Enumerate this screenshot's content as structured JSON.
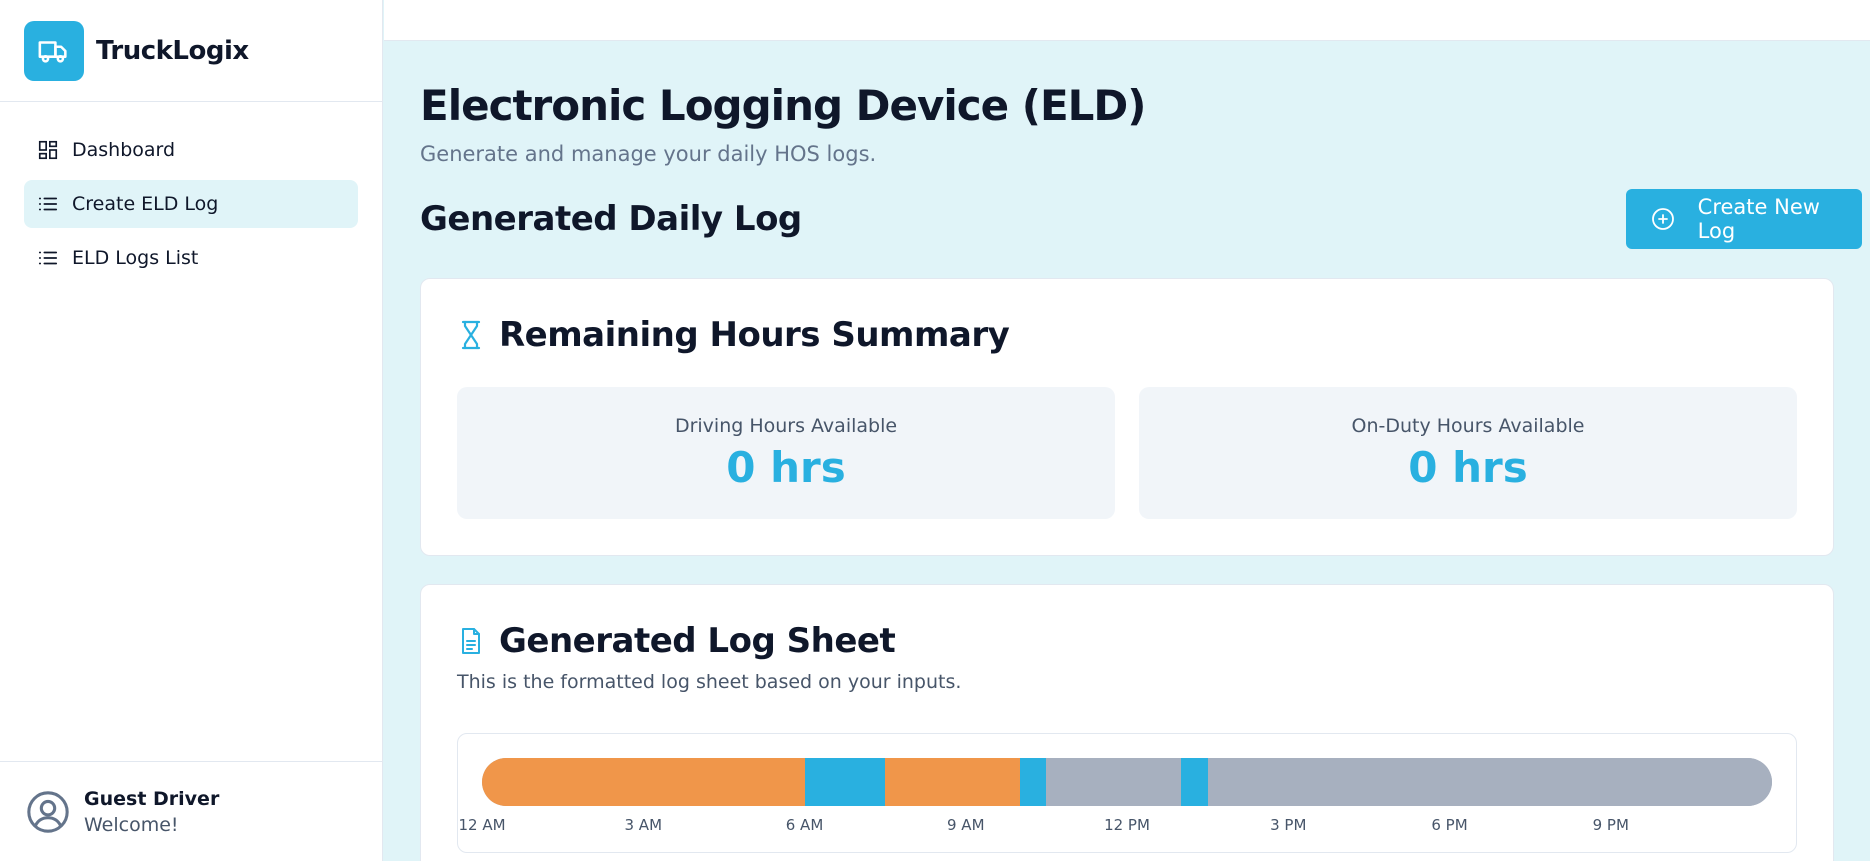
{
  "brand": {
    "name": "TruckLogix",
    "logo_icon": "truck-icon",
    "accent": "#29b0e0"
  },
  "nav": {
    "items": [
      {
        "label": "Dashboard",
        "icon": "dashboard-icon",
        "active": false
      },
      {
        "label": "Create ELD Log",
        "icon": "list-icon",
        "active": true
      },
      {
        "label": "ELD Logs List",
        "icon": "list-icon",
        "active": false
      }
    ]
  },
  "user": {
    "name": "Guest Driver",
    "greeting": "Welcome!",
    "icon": "user-circle-icon"
  },
  "page": {
    "title": "Electronic Logging Device (ELD)",
    "subtitle": "Generate and manage your daily HOS logs.",
    "section_title": "Generated Daily Log",
    "create_button": "Create New Log"
  },
  "summary": {
    "title": "Remaining Hours Summary",
    "icon": "hourglass-icon",
    "stats": [
      {
        "label": "Driving Hours Available",
        "value": "0 hrs"
      },
      {
        "label": "On-Duty Hours Available",
        "value": "0 hrs"
      }
    ]
  },
  "log_sheet": {
    "title": "Generated Log Sheet",
    "icon": "document-icon",
    "description": "This is the formatted log sheet based on your inputs.",
    "colors": {
      "orange": "#f0964a",
      "blue": "#29b0e0",
      "gray": "#a7b0bf"
    },
    "segments": [
      {
        "start": 0,
        "end": 6,
        "color": "#f0964a"
      },
      {
        "start": 6,
        "end": 7.5,
        "color": "#29b0e0"
      },
      {
        "start": 7.5,
        "end": 10,
        "color": "#f0964a"
      },
      {
        "start": 10,
        "end": 10.5,
        "color": "#29b0e0"
      },
      {
        "start": 10.5,
        "end": 13,
        "color": "#a7b0bf"
      },
      {
        "start": 13,
        "end": 13.5,
        "color": "#29b0e0"
      },
      {
        "start": 13.5,
        "end": 24,
        "color": "#a7b0bf"
      }
    ],
    "axis_end": 24,
    "ticks": [
      {
        "hour": 0,
        "label": "12 AM"
      },
      {
        "hour": 3,
        "label": "3 AM"
      },
      {
        "hour": 6,
        "label": "6 AM"
      },
      {
        "hour": 9,
        "label": "9 AM"
      },
      {
        "hour": 12,
        "label": "12 PM"
      },
      {
        "hour": 15,
        "label": "3 PM"
      },
      {
        "hour": 18,
        "label": "6 PM"
      },
      {
        "hour": 21,
        "label": "9 PM"
      }
    ]
  }
}
